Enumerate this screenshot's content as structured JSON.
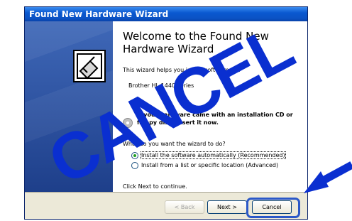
{
  "window": {
    "title": "Found New Hardware Wizard"
  },
  "content": {
    "heading": "Welcome to the Found New Hardware Wizard",
    "intro": "This wizard helps you install software for:",
    "device": "Brother HL-1440 series",
    "cd_prompt": "If your hardware came with an installation CD or floppy disk, insert it now.",
    "question": "What do you want the wizard to do?",
    "options": [
      {
        "label": "Install the software automatically (Recommended)",
        "checked": true
      },
      {
        "label": "Install from a list or specific location (Advanced)",
        "checked": false
      }
    ],
    "footer": "Click Next to continue."
  },
  "buttons": {
    "back": "< Back",
    "next": "Next >",
    "cancel": "Cancel"
  },
  "overlay": {
    "stamp_text": "CANCEL",
    "stamp_color": "#0a2fd0",
    "arrow_color": "#0a2fd0"
  }
}
